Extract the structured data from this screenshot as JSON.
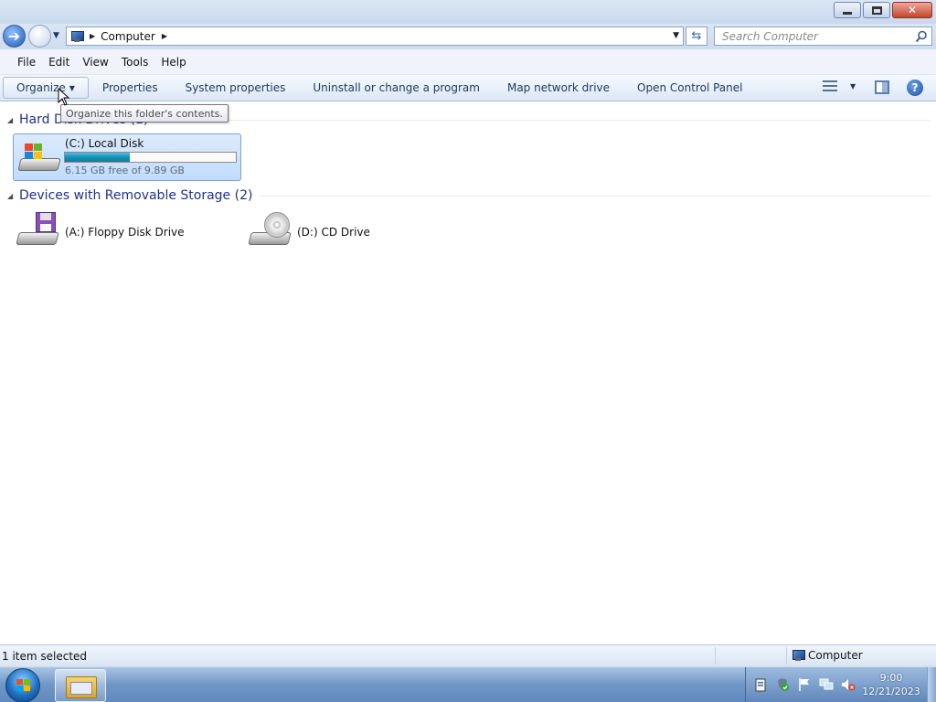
{
  "window": {
    "controls": {
      "minimize_icon": "minimize-icon",
      "maximize_icon": "restore-icon",
      "close_icon": "close-icon"
    }
  },
  "address_bar": {
    "location_icon": "computer-icon",
    "breadcrumbs": [
      "Computer"
    ],
    "search_placeholder": "Search Computer"
  },
  "menu": {
    "items": [
      "File",
      "Edit",
      "View",
      "Tools",
      "Help"
    ]
  },
  "command_bar": {
    "buttons": [
      "Organize",
      "Properties",
      "System properties",
      "Uninstall or change a program",
      "Map network drive",
      "Open Control Panel"
    ]
  },
  "tooltip": {
    "text": "Organize this folder's contents."
  },
  "groups": [
    {
      "title": "Hard Disk Drives (1)",
      "items": [
        {
          "name": "(C:) Local Disk",
          "free_text": "6.15 GB free of 9.89 GB",
          "used_fraction": 0.378,
          "selected": true,
          "icon": "hard-drive-icon"
        }
      ]
    },
    {
      "title": "Devices with Removable Storage (2)",
      "items": [
        {
          "name": "(A:) Floppy Disk Drive",
          "icon": "floppy-drive-icon"
        },
        {
          "name": "(D:) CD Drive",
          "icon": "cd-drive-icon"
        }
      ]
    }
  ],
  "status_bar": {
    "selection": "1 item selected",
    "location": "Computer"
  },
  "taskbar": {
    "clock_time": "9:00",
    "clock_date": "12/21/2023"
  },
  "colors": {
    "accent": "#1e3287",
    "selection_fill": "#c1dcfc",
    "progress_fill": "#1a8fb6",
    "taskbar": "#6f96c6"
  }
}
